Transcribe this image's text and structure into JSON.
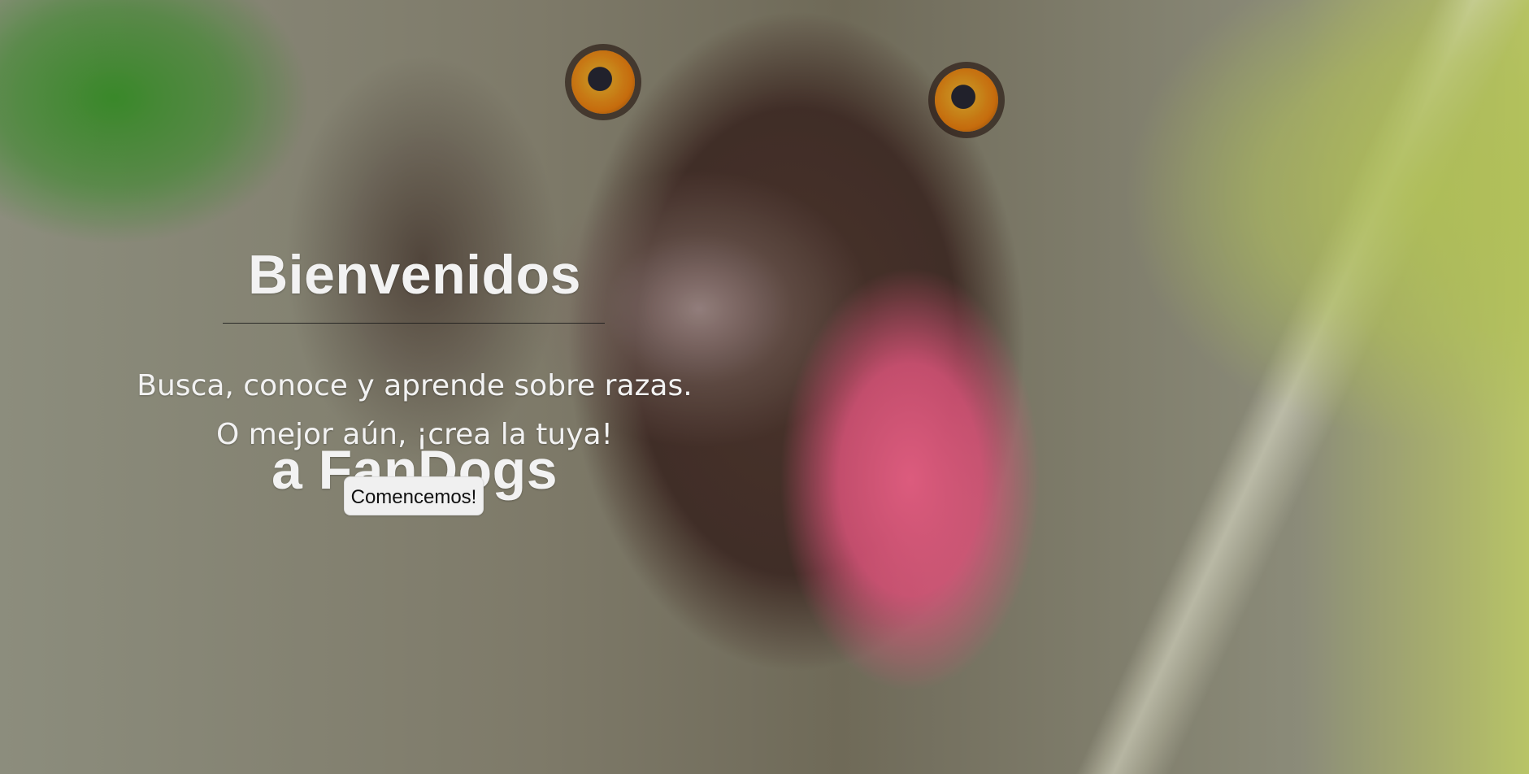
{
  "hero": {
    "title_line_1": "Bienvenidos",
    "title_line_2": "a FanDogs",
    "subtitle_line_1": "Busca, conoce y aprende sobre razas.",
    "subtitle_line_2": "O mejor aún, ¡crea la tuya!",
    "cta_label": "Comencemos!"
  },
  "colors": {
    "text_primary": "#f2f2f2",
    "button_bg": "#f0f0f0",
    "divider": "#1b1b1b"
  }
}
